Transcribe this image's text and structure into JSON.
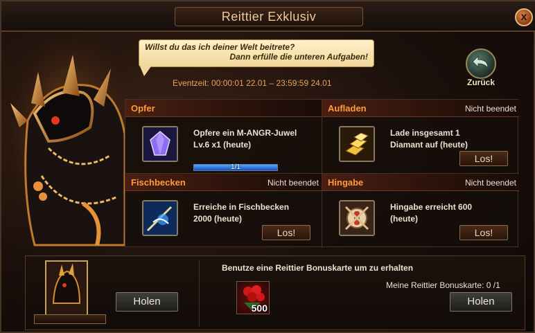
{
  "window": {
    "title": "Reittier Exklusiv",
    "close_label": "x"
  },
  "speech": {
    "line1": "Willst du das ich deiner Welt beitrete?",
    "line2": "Dann erfülle die unteren Aufgaben!"
  },
  "event_time": "Eventzeit: 00:00:01 22.01 – 23:59:59 24.01",
  "back": {
    "label": "Zurück",
    "icon": "back-arrow-icon"
  },
  "tasks": [
    {
      "name": "Opfer",
      "status": "",
      "desc_line1": "Opfere ein M-ANGR-Juwel",
      "desc_line2": "Lv.6 x1 (heute)",
      "progress_text": "1/1",
      "progress": 1.0,
      "icon": "purple-gem-icon"
    },
    {
      "name": "Aufladen",
      "status": "Nicht beendet",
      "desc_line1": "Lade insgesamt 1",
      "desc_line2": "Diamant auf (heute)",
      "button": "Los!",
      "icon": "gold-bars-icon"
    },
    {
      "name": "Fischbecken",
      "status": "Nicht beendet",
      "desc_line1": "Erreiche in Fischbecken",
      "desc_line2": "2000 (heute)",
      "button": "Los!",
      "icon": "fishing-icon"
    },
    {
      "name": "Hingabe",
      "status": "Nicht beendet",
      "desc_line1": "Hingabe erreicht 600",
      "desc_line2": "(heute)",
      "button": "Los!",
      "icon": "hingabe-crest-icon"
    }
  ],
  "bottom": {
    "left_button": "Holen",
    "right_button": "Holen",
    "bonus_title": "Benutze eine Reittier Bonuskarte um zu erhalten",
    "bonus_count": "Meine Reittier Bonuskarte: 0 /1",
    "reward_amount": "500",
    "reward_icon": "rose-bouquet-icon"
  },
  "colors": {
    "accent": "#ff9c3a",
    "title": "#f0c89a",
    "progress": "#3a7fe0"
  }
}
